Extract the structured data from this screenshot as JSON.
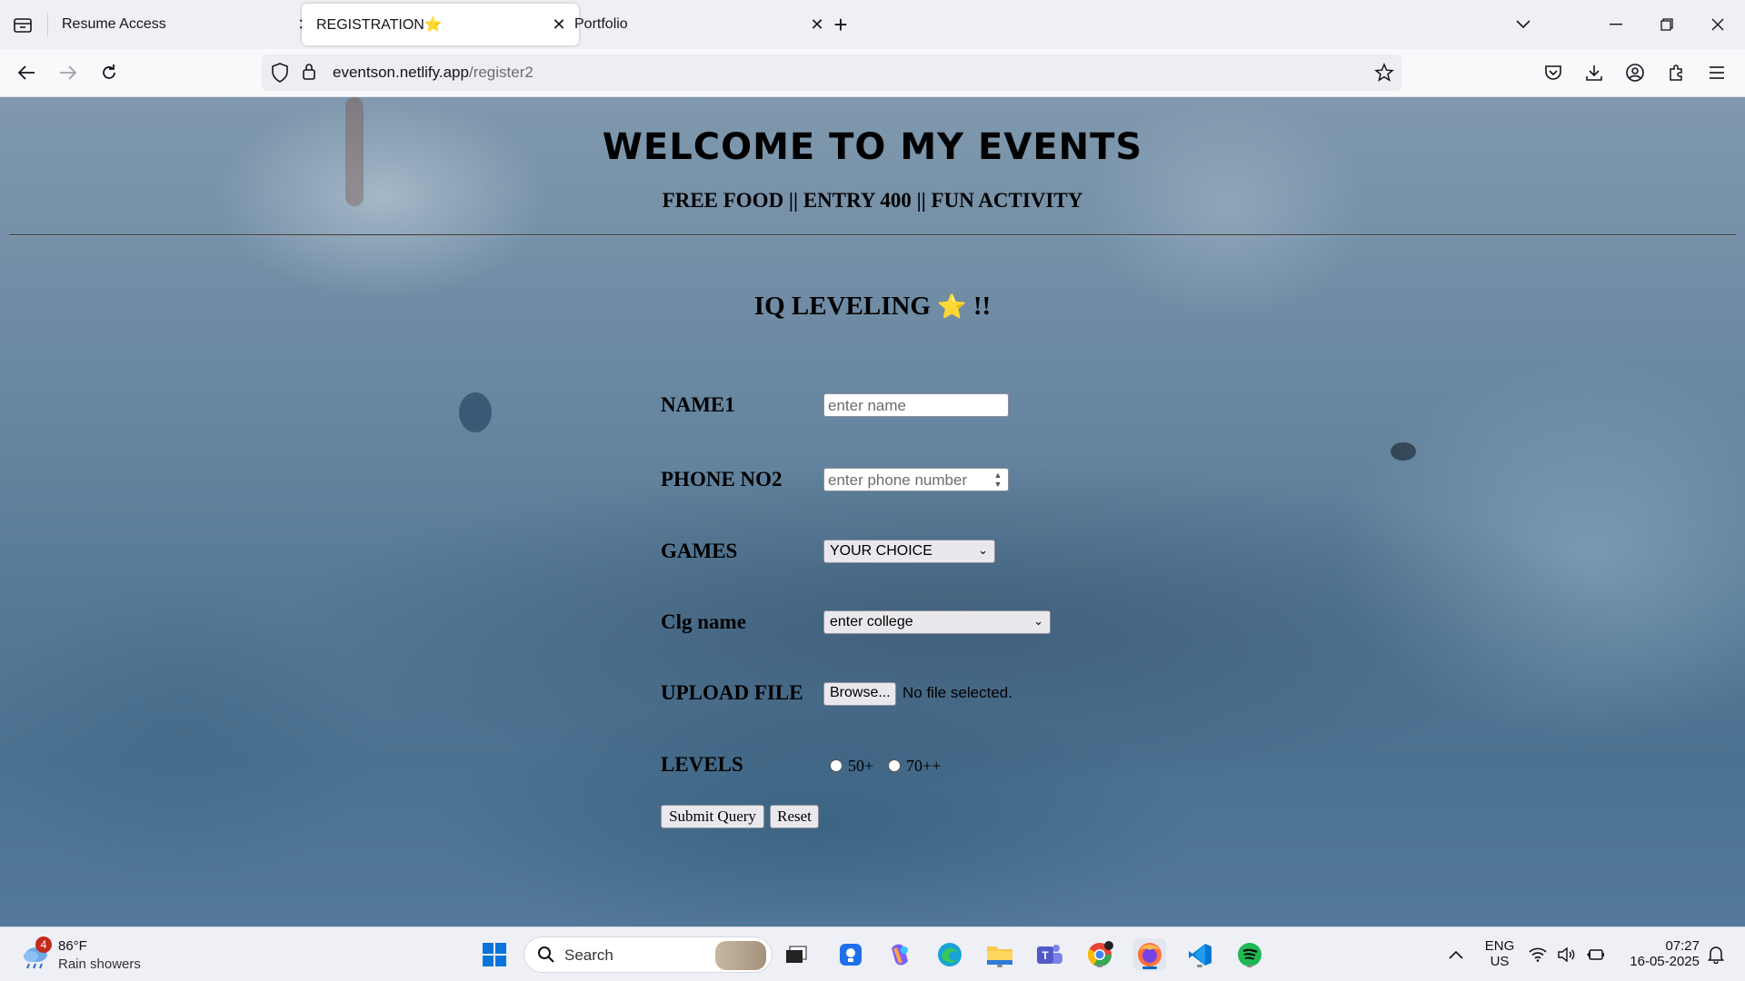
{
  "browser": {
    "tabs": [
      {
        "title": "Resume Access",
        "active": false
      },
      {
        "title": "REGISTRATION⭐",
        "active": true
      },
      {
        "title": "Portfolio",
        "active": false
      }
    ],
    "url_host": "eventson.netlify.app",
    "url_path": "/register2"
  },
  "page": {
    "title": "WELCOME TO MY EVENTS",
    "subtitle": "FREE FOOD || ENTRY 400 || FUN ACTIVITY",
    "section_title": "IQ LEVELING",
    "section_suffix": "!!",
    "form": {
      "name_label": "NAME1",
      "name_placeholder": "enter name",
      "phone_label": "PHONE NO2",
      "phone_placeholder": "enter phone number",
      "games_label": "GAMES",
      "games_selected": "YOUR CHOICE",
      "college_label": "Clg name",
      "college_selected": "enter college",
      "upload_label": "UPLOAD FILE",
      "browse_label": "Browse...",
      "no_file_text": "No file selected.",
      "levels_label": "LEVELS",
      "level_options": [
        "50+",
        "70++"
      ],
      "submit_label": "Submit Query",
      "reset_label": "Reset"
    }
  },
  "taskbar": {
    "weather_temp": "86°F",
    "weather_desc": "Rain showers",
    "weather_badge": "4",
    "search_placeholder": "Search",
    "lang_line1": "ENG",
    "lang_line2": "US",
    "time": "07:27",
    "date": "16-05-2025"
  },
  "colors": {
    "accent": "#0067c0",
    "page_bg": "#5f7f9a"
  }
}
